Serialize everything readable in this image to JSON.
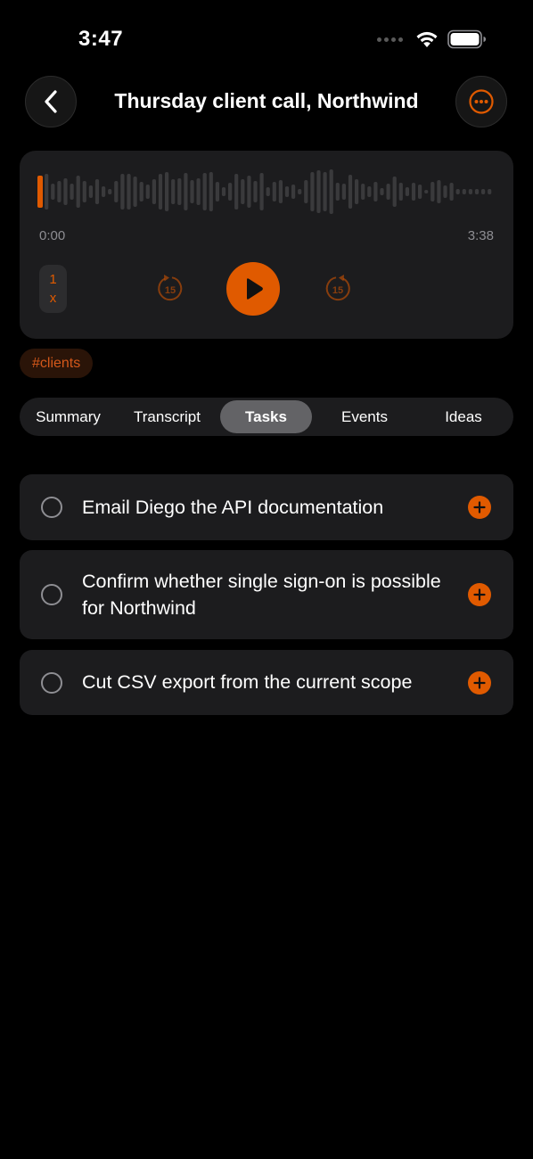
{
  "status_bar": {
    "time": "3:47"
  },
  "header": {
    "title": "Thursday client call, Northwind",
    "back_icon": "chevron-left-icon",
    "more_icon": "ellipsis-circle-icon"
  },
  "player": {
    "current_time": "0:00",
    "duration": "3:38",
    "progress": 0.0,
    "speed_value": "1",
    "speed_unit": "x",
    "skip_back_label": "15",
    "skip_forward_label": "15",
    "play_icon": "play-icon"
  },
  "tag": {
    "label": "#clients"
  },
  "tabs": [
    {
      "label": "Summary",
      "active": false
    },
    {
      "label": "Transcript",
      "active": false
    },
    {
      "label": "Tasks",
      "active": true
    },
    {
      "label": "Events",
      "active": false
    },
    {
      "label": "Ideas",
      "active": false
    }
  ],
  "tasks": [
    {
      "text": "Email Diego the API documentation",
      "done": false
    },
    {
      "text": "Confirm whether single sign-on is possible for Northwind",
      "done": false
    },
    {
      "text": "Cut CSV export from the current scope",
      "done": false
    }
  ],
  "colors": {
    "accent": "#e05a00",
    "background": "#000000",
    "card": "#1c1c1e",
    "waveform": "#3a3a3c",
    "secondary_text": "#8e8e93"
  }
}
